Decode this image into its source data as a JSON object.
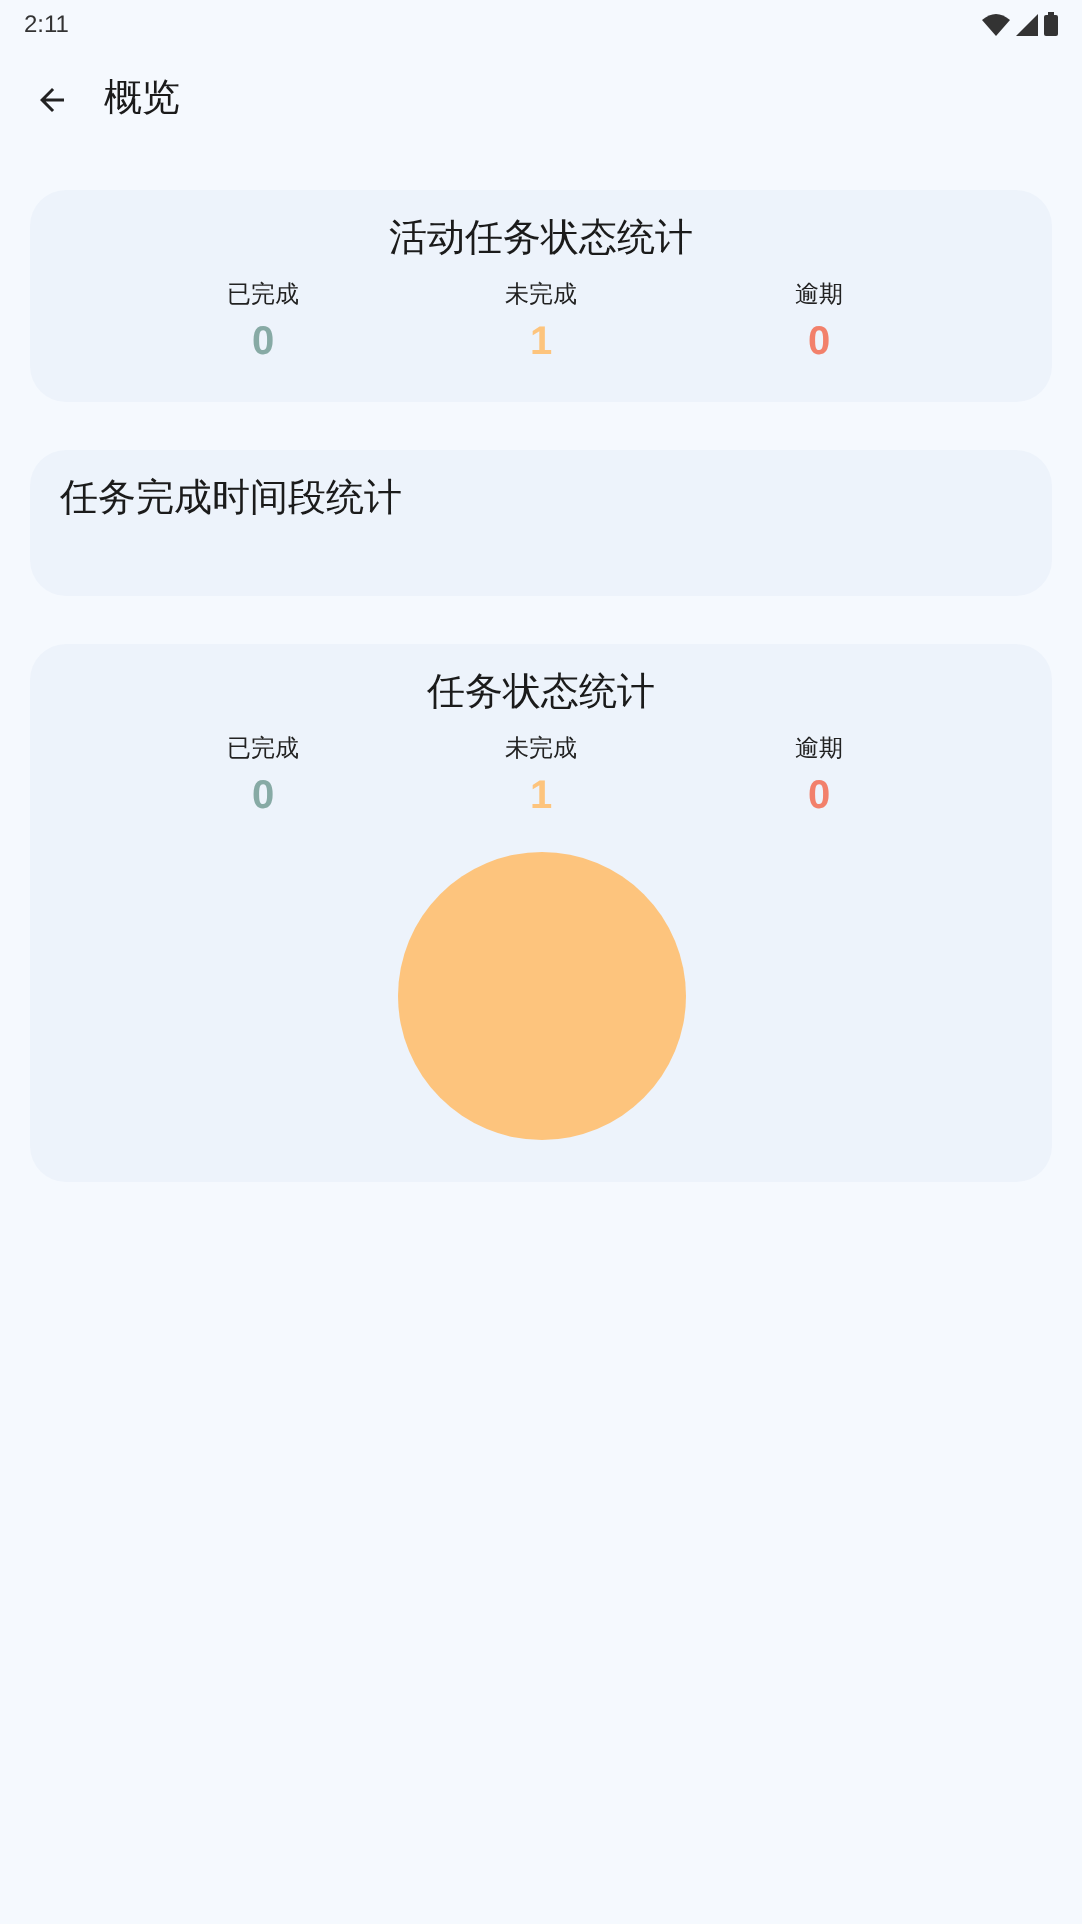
{
  "status_bar": {
    "time": "2:11"
  },
  "header": {
    "title": "概览"
  },
  "active_stats": {
    "title": "活动任务状态统计",
    "items": [
      {
        "label": "已完成",
        "value": "0",
        "color": "#87aaa5"
      },
      {
        "label": "未完成",
        "value": "1",
        "color": "#fdc47d"
      },
      {
        "label": "逾期",
        "value": "0",
        "color": "#f2806b"
      }
    ]
  },
  "time_stats": {
    "title": "任务完成时间段统计"
  },
  "task_stats": {
    "title": "任务状态统计",
    "items": [
      {
        "label": "已完成",
        "value": "0",
        "color": "#87aaa5"
      },
      {
        "label": "未完成",
        "value": "1",
        "color": "#fdc47d"
      },
      {
        "label": "逾期",
        "value": "0",
        "color": "#f2806b"
      }
    ]
  }
}
